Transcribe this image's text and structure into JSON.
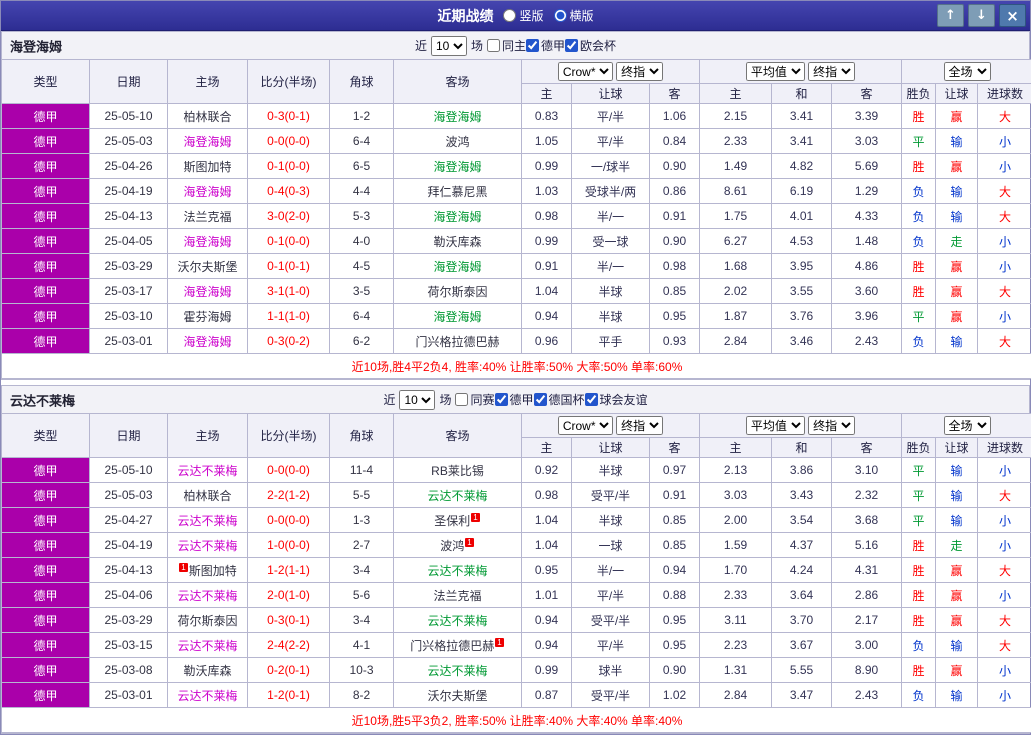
{
  "titlebar": {
    "title": "近期战绩",
    "layout_options": [
      {
        "label": "竖版",
        "selected": false
      },
      {
        "label": "横版",
        "selected": true
      }
    ],
    "window_buttons": {
      "up": "↑",
      "down": "↓",
      "close": "×"
    }
  },
  "result_colors": {
    "win": "#ff0000",
    "draw": "#009933",
    "lose": "#0033cc"
  },
  "sections": [
    {
      "team": "海登海姆",
      "filter": {
        "prefix": "近",
        "count": "10",
        "suffix": "场",
        "checkboxes": [
          {
            "label": "同主",
            "checked": false
          },
          {
            "label": "德甲",
            "checked": true
          },
          {
            "label": "欧会杯",
            "checked": true
          }
        ]
      },
      "table": {
        "col_headers": [
          "类型",
          "日期",
          "主场",
          "比分(半场)",
          "角球",
          "客场"
        ],
        "selects": {
          "company": "Crow*",
          "company_stage": "终指",
          "avg": "平均值",
          "avg_stage": "终指",
          "scope": "全场"
        },
        "sub_headers": [
          "主",
          "让球",
          "客",
          "主",
          "和",
          "客",
          "胜负",
          "让球",
          "进球数"
        ],
        "rows": [
          {
            "league": "德甲",
            "date": "25-05-10",
            "home": {
              "name": "柏林联合"
            },
            "score": "0-3(0-1)",
            "corner": "1-2",
            "away": {
              "name": "海登海姆",
              "hl": "away"
            },
            "odds": [
              "0.83",
              "平/半",
              "1.06"
            ],
            "avg": [
              "2.15",
              "3.41",
              "3.39"
            ],
            "results": [
              "胜",
              "赢",
              "大"
            ]
          },
          {
            "league": "德甲",
            "date": "25-05-03",
            "home": {
              "name": "海登海姆",
              "hl": "home"
            },
            "score": "0-0(0-0)",
            "corner": "6-4",
            "away": {
              "name": "波鸿"
            },
            "odds": [
              "1.05",
              "平/半",
              "0.84"
            ],
            "avg": [
              "2.33",
              "3.41",
              "3.03"
            ],
            "results": [
              "平",
              "输",
              "小"
            ]
          },
          {
            "league": "德甲",
            "date": "25-04-26",
            "home": {
              "name": "斯图加特"
            },
            "score": "0-1(0-0)",
            "corner": "6-5",
            "away": {
              "name": "海登海姆",
              "hl": "away"
            },
            "odds": [
              "0.99",
              "一/球半",
              "0.90"
            ],
            "avg": [
              "1.49",
              "4.82",
              "5.69"
            ],
            "results": [
              "胜",
              "赢",
              "小"
            ]
          },
          {
            "league": "德甲",
            "date": "25-04-19",
            "home": {
              "name": "海登海姆",
              "hl": "home"
            },
            "score": "0-4(0-3)",
            "corner": "4-4",
            "away": {
              "name": "拜仁慕尼黑"
            },
            "odds": [
              "1.03",
              "受球半/两",
              "0.86"
            ],
            "avg": [
              "8.61",
              "6.19",
              "1.29"
            ],
            "results": [
              "负",
              "输",
              "大"
            ]
          },
          {
            "league": "德甲",
            "date": "25-04-13",
            "home": {
              "name": "法兰克福"
            },
            "score": "3-0(2-0)",
            "corner": "5-3",
            "away": {
              "name": "海登海姆",
              "hl": "away"
            },
            "odds": [
              "0.98",
              "半/一",
              "0.91"
            ],
            "avg": [
              "1.75",
              "4.01",
              "4.33"
            ],
            "results": [
              "负",
              "输",
              "大"
            ]
          },
          {
            "league": "德甲",
            "date": "25-04-05",
            "home": {
              "name": "海登海姆",
              "hl": "home"
            },
            "score": "0-1(0-0)",
            "corner": "4-0",
            "away": {
              "name": "勒沃库森"
            },
            "odds": [
              "0.99",
              "受一球",
              "0.90"
            ],
            "avg": [
              "6.27",
              "4.53",
              "1.48"
            ],
            "results": [
              "负",
              "走",
              "小"
            ]
          },
          {
            "league": "德甲",
            "date": "25-03-29",
            "home": {
              "name": "沃尔夫斯堡"
            },
            "score": "0-1(0-1)",
            "corner": "4-5",
            "away": {
              "name": "海登海姆",
              "hl": "away"
            },
            "odds": [
              "0.91",
              "半/一",
              "0.98"
            ],
            "avg": [
              "1.68",
              "3.95",
              "4.86"
            ],
            "results": [
              "胜",
              "赢",
              "小"
            ]
          },
          {
            "league": "德甲",
            "date": "25-03-17",
            "home": {
              "name": "海登海姆",
              "hl": "home"
            },
            "score": "3-1(1-0)",
            "corner": "3-5",
            "away": {
              "name": "荷尔斯泰因"
            },
            "odds": [
              "1.04",
              "半球",
              "0.85"
            ],
            "avg": [
              "2.02",
              "3.55",
              "3.60"
            ],
            "results": [
              "胜",
              "赢",
              "大"
            ]
          },
          {
            "league": "德甲",
            "date": "25-03-10",
            "home": {
              "name": "霍芬海姆"
            },
            "score": "1-1(1-0)",
            "corner": "6-4",
            "away": {
              "name": "海登海姆",
              "hl": "away"
            },
            "odds": [
              "0.94",
              "半球",
              "0.95"
            ],
            "avg": [
              "1.87",
              "3.76",
              "3.96"
            ],
            "results": [
              "平",
              "赢",
              "小"
            ]
          },
          {
            "league": "德甲",
            "date": "25-03-01",
            "home": {
              "name": "海登海姆",
              "hl": "home"
            },
            "score": "0-3(0-2)",
            "corner": "6-2",
            "away": {
              "name": "门兴格拉德巴赫"
            },
            "odds": [
              "0.96",
              "平手",
              "0.93"
            ],
            "avg": [
              "2.84",
              "3.46",
              "2.43"
            ],
            "results": [
              "负",
              "输",
              "大"
            ]
          }
        ],
        "summary": "近10场,胜4平2负4, 胜率:40% 让胜率:50% 大率:50% 单率:60%"
      }
    },
    {
      "team": "云达不莱梅",
      "filter": {
        "prefix": "近",
        "count": "10",
        "suffix": "场",
        "checkboxes": [
          {
            "label": "同赛",
            "checked": false
          },
          {
            "label": "德甲",
            "checked": true
          },
          {
            "label": "德国杯",
            "checked": true
          },
          {
            "label": "球会友谊",
            "checked": true
          }
        ]
      },
      "table": {
        "col_headers": [
          "类型",
          "日期",
          "主场",
          "比分(半场)",
          "角球",
          "客场"
        ],
        "selects": {
          "company": "Crow*",
          "company_stage": "终指",
          "avg": "平均值",
          "avg_stage": "终指",
          "scope": "全场"
        },
        "sub_headers": [
          "主",
          "让球",
          "客",
          "主",
          "和",
          "客",
          "胜负",
          "让球",
          "进球数"
        ],
        "rows": [
          {
            "league": "德甲",
            "date": "25-05-10",
            "home": {
              "name": "云达不莱梅",
              "hl": "home"
            },
            "score": "0-0(0-0)",
            "corner": "11-4",
            "away": {
              "name": "RB莱比锡"
            },
            "odds": [
              "0.92",
              "半球",
              "0.97"
            ],
            "avg": [
              "2.13",
              "3.86",
              "3.10"
            ],
            "results": [
              "平",
              "输",
              "小"
            ]
          },
          {
            "league": "德甲",
            "date": "25-05-03",
            "home": {
              "name": "柏林联合"
            },
            "score": "2-2(1-2)",
            "corner": "5-5",
            "away": {
              "name": "云达不莱梅",
              "hl": "away"
            },
            "odds": [
              "0.98",
              "受平/半",
              "0.91"
            ],
            "avg": [
              "3.03",
              "3.43",
              "2.32"
            ],
            "results": [
              "平",
              "输",
              "大"
            ]
          },
          {
            "league": "德甲",
            "date": "25-04-27",
            "home": {
              "name": "云达不莱梅",
              "hl": "home"
            },
            "score": "0-0(0-0)",
            "corner": "1-3",
            "away": {
              "name": "圣保利",
              "badge": "1",
              "badge_pos": "after"
            },
            "odds": [
              "1.04",
              "半球",
              "0.85"
            ],
            "avg": [
              "2.00",
              "3.54",
              "3.68"
            ],
            "results": [
              "平",
              "输",
              "小"
            ]
          },
          {
            "league": "德甲",
            "date": "25-04-19",
            "home": {
              "name": "云达不莱梅",
              "hl": "home"
            },
            "score": "1-0(0-0)",
            "corner": "2-7",
            "away": {
              "name": "波鸿",
              "badge": "1",
              "badge_pos": "after"
            },
            "odds": [
              "1.04",
              "一球",
              "0.85"
            ],
            "avg": [
              "1.59",
              "4.37",
              "5.16"
            ],
            "results": [
              "胜",
              "走",
              "小"
            ]
          },
          {
            "league": "德甲",
            "date": "25-04-13",
            "home": {
              "name": "斯图加特",
              "badge": "1",
              "badge_pos": "before"
            },
            "score": "1-2(1-1)",
            "corner": "3-4",
            "away": {
              "name": "云达不莱梅",
              "hl": "away"
            },
            "odds": [
              "0.95",
              "半/一",
              "0.94"
            ],
            "avg": [
              "1.70",
              "4.24",
              "4.31"
            ],
            "results": [
              "胜",
              "赢",
              "大"
            ]
          },
          {
            "league": "德甲",
            "date": "25-04-06",
            "home": {
              "name": "云达不莱梅",
              "hl": "home"
            },
            "score": "2-0(1-0)",
            "corner": "5-6",
            "away": {
              "name": "法兰克福"
            },
            "odds": [
              "1.01",
              "平/半",
              "0.88"
            ],
            "avg": [
              "2.33",
              "3.64",
              "2.86"
            ],
            "results": [
              "胜",
              "赢",
              "小"
            ]
          },
          {
            "league": "德甲",
            "date": "25-03-29",
            "home": {
              "name": "荷尔斯泰因"
            },
            "score": "0-3(0-1)",
            "corner": "3-4",
            "away": {
              "name": "云达不莱梅",
              "hl": "away"
            },
            "odds": [
              "0.94",
              "受平/半",
              "0.95"
            ],
            "avg": [
              "3.11",
              "3.70",
              "2.17"
            ],
            "results": [
              "胜",
              "赢",
              "大"
            ]
          },
          {
            "league": "德甲",
            "date": "25-03-15",
            "home": {
              "name": "云达不莱梅",
              "hl": "home"
            },
            "score": "2-4(2-2)",
            "corner": "4-1",
            "away": {
              "name": "门兴格拉德巴赫",
              "badge": "1",
              "badge_pos": "after"
            },
            "odds": [
              "0.94",
              "平/半",
              "0.95"
            ],
            "avg": [
              "2.23",
              "3.67",
              "3.00"
            ],
            "results": [
              "负",
              "输",
              "大"
            ]
          },
          {
            "league": "德甲",
            "date": "25-03-08",
            "home": {
              "name": "勒沃库森"
            },
            "score": "0-2(0-1)",
            "corner": "10-3",
            "away": {
              "name": "云达不莱梅",
              "hl": "away"
            },
            "odds": [
              "0.99",
              "球半",
              "0.90"
            ],
            "avg": [
              "1.31",
              "5.55",
              "8.90"
            ],
            "results": [
              "胜",
              "赢",
              "小"
            ]
          },
          {
            "league": "德甲",
            "date": "25-03-01",
            "home": {
              "name": "云达不莱梅",
              "hl": "home"
            },
            "score": "1-2(0-1)",
            "corner": "8-2",
            "away": {
              "name": "沃尔夫斯堡"
            },
            "odds": [
              "0.87",
              "受平/半",
              "1.02"
            ],
            "avg": [
              "2.84",
              "3.47",
              "2.43"
            ],
            "results": [
              "负",
              "输",
              "小"
            ]
          }
        ],
        "summary": "近10场,胜5平3负2, 胜率:50% 让胜率:40% 大率:40% 单率:40%"
      }
    }
  ]
}
